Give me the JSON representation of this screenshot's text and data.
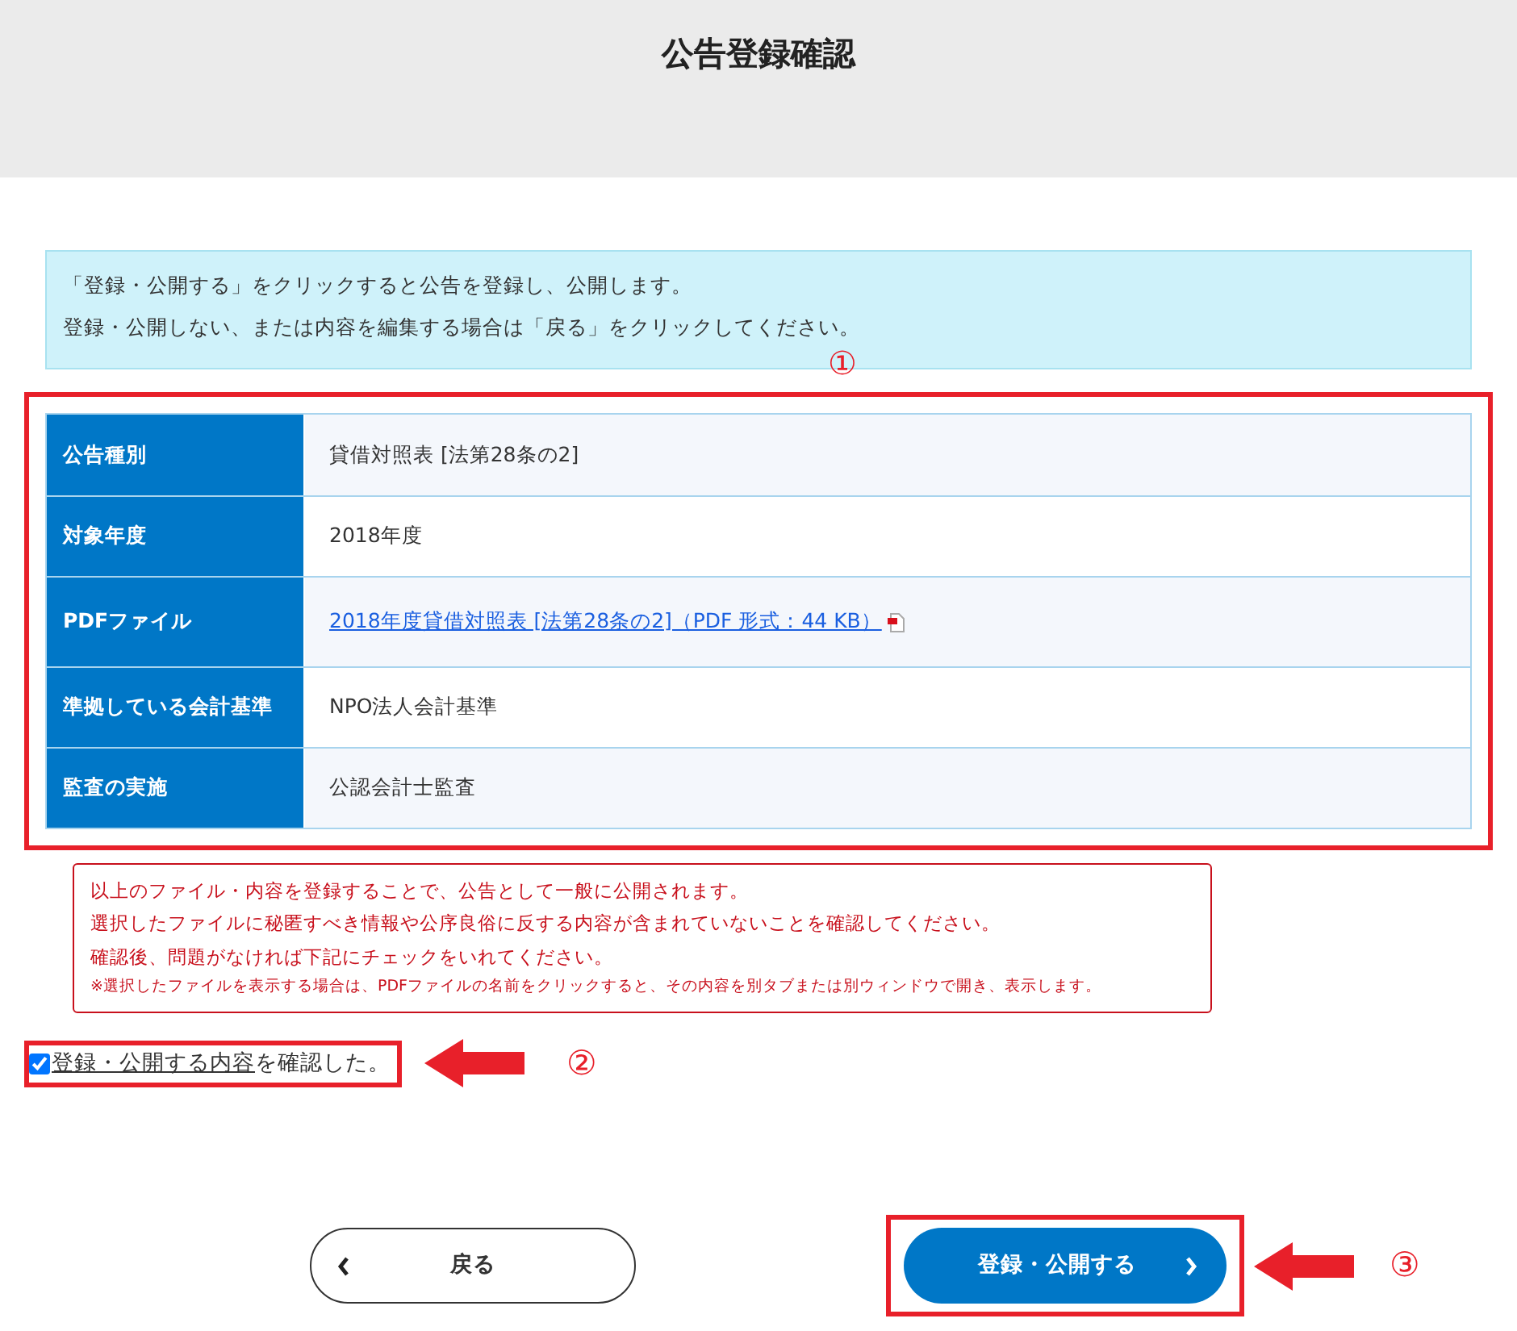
{
  "header": {
    "title": "公告登録確認"
  },
  "info": [
    "「登録・公開する」をクリックすると公告を登録し、公開します。",
    "登録・公開しない、または内容を編集する場合は「戻る」をクリックしてください。"
  ],
  "markers": [
    "①",
    "②",
    "③"
  ],
  "table": {
    "rows": [
      {
        "label": "公告種別",
        "kind": "text",
        "value": "貸借対照表 [法第28条の2]"
      },
      {
        "label": "対象年度",
        "kind": "text",
        "value": "2018年度"
      },
      {
        "label": "PDFファイル",
        "kind": "link",
        "value": "2018年度貸借対照表 [法第28条の2]（PDF 形式：44 KB）"
      },
      {
        "label": "準拠している会計基準",
        "kind": "text",
        "value": "NPO法人会計基準"
      },
      {
        "label": "監査の実施",
        "kind": "text",
        "value": "公認会計士監査"
      }
    ]
  },
  "notice": [
    "以上のファイル・内容を登録することで、公告として一般に公開されます。",
    "選択したファイルに秘匿すべき情報や公序良俗に反する内容が含まれていないことを確認してください。",
    "確認後、問題がなければ下記にチェックをいれてください。"
  ],
  "notice_note": "※選択したファイルを表示する場合は、PDFファイルの名前をクリックすると、その内容を別タブまたは別ウィンドウで開き、表示します。",
  "confirm": {
    "checked": true,
    "link_text": "登録・公開する内容",
    "text": "を確認した。"
  },
  "buttons": {
    "back": "戻る",
    "submit": "登録・公開する"
  }
}
